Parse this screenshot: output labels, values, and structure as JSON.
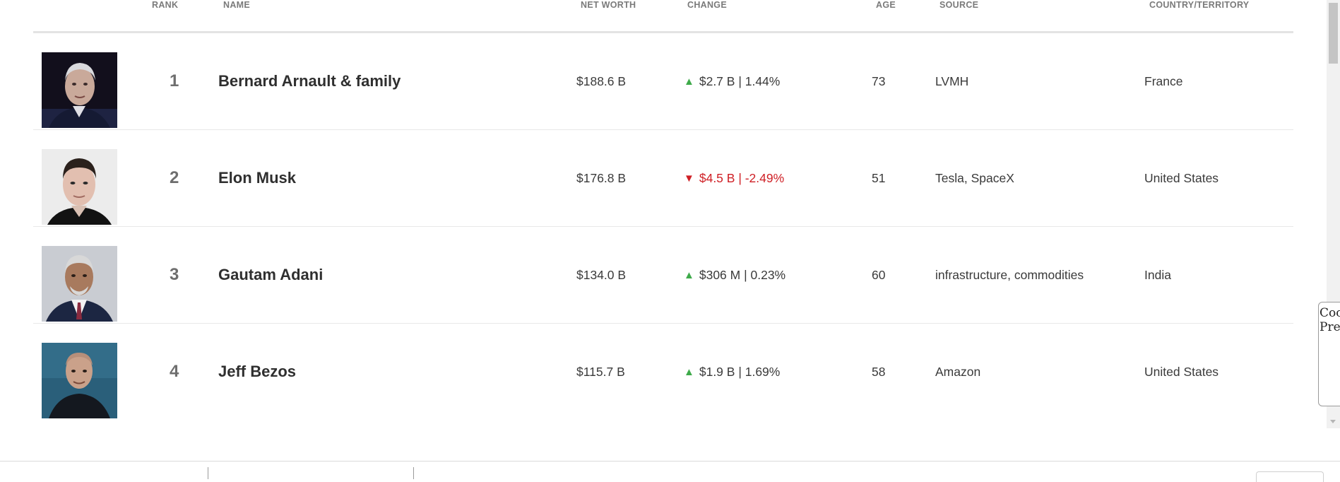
{
  "columns": {
    "rank": "RANK",
    "name": "NAME",
    "net_worth": "NET WORTH",
    "change": "CHANGE",
    "age": "AGE",
    "source": "SOURCE",
    "country": "COUNTRY/TERRITORY"
  },
  "rows": [
    {
      "rank": "1",
      "name": "Bernard Arnault & family",
      "net_worth": "$188.6 B",
      "direction": "up",
      "change": "$2.7 B | 1.44%",
      "age": "73",
      "source": "LVMH",
      "country": "France"
    },
    {
      "rank": "2",
      "name": "Elon Musk",
      "net_worth": "$176.8 B",
      "direction": "down",
      "change": "$4.5 B | -2.49%",
      "age": "51",
      "source": "Tesla, SpaceX",
      "country": "United States"
    },
    {
      "rank": "3",
      "name": "Gautam Adani",
      "net_worth": "$134.0 B",
      "direction": "up",
      "change": "$306 M | 0.23%",
      "age": "60",
      "source": "infrastructure, commodities",
      "country": "India"
    },
    {
      "rank": "4",
      "name": "Jeff Bezos",
      "net_worth": "$115.7 B",
      "direction": "up",
      "change": "$1.9 B | 1.69%",
      "age": "58",
      "source": "Amazon",
      "country": "United States"
    }
  ],
  "side_panel": {
    "line1": "Coo",
    "line2": "Pre"
  },
  "colors": {
    "up": "#3eaa4a",
    "down": "#cf1f25"
  },
  "icons": {
    "up": "triangle-up-icon",
    "down": "triangle-down-icon"
  }
}
